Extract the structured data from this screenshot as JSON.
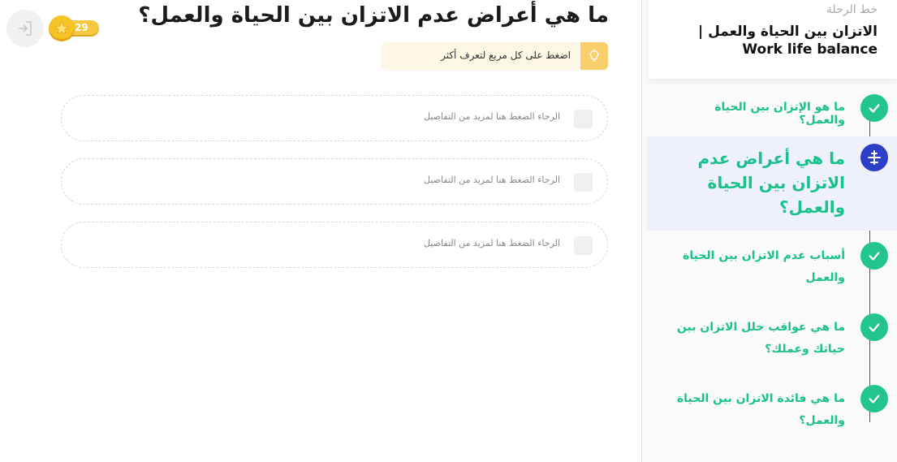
{
  "sidebar": {
    "caption": "خط الرحلة",
    "title_ar": "الاتزان بين الحياة والعمل |",
    "title_en": "Work life balance",
    "steps": [
      {
        "label": "ما هو الإتزان بين الحياة والعمل؟",
        "status": "completed"
      },
      {
        "label": "ما هي أعراض عدم الاتزان بين الحياة والعمل؟",
        "status": "current"
      },
      {
        "label": "أسباب عدم الاتزان بين الحياة والعمل",
        "status": "completed"
      },
      {
        "label": "ما هي عواقب خلل الاتزان بين حياتك وعملك؟",
        "status": "completed"
      },
      {
        "label": "ما هي فائدة الاتزان بين الحياة والعمل؟",
        "status": "completed"
      }
    ]
  },
  "header": {
    "title": "ما هي أعراض عدم الاتزان بين الحياة والعمل؟",
    "coins": "29",
    "hint": "اضغط على كل مربع لتعرف أكثر"
  },
  "cards": [
    {
      "text": "الرجاء الضغط هنا لمزيد من التفاصيل"
    },
    {
      "text": "الرجاء الضغط هنا لمزيد من التفاصيل"
    },
    {
      "text": "الرجاء الضغط هنا لمزيد من التفاصيل"
    }
  ],
  "icons": {
    "exit": "exit-icon",
    "coin": "star-coin-icon",
    "hint": "lightbulb-icon",
    "done": "check-icon",
    "current": "airplane-icon"
  },
  "colors": {
    "completed": "#22c58b",
    "current": "#2d3ec9",
    "step_text": "#19c28a",
    "coin": "#f6c327",
    "hint_bg": "#fdf7e5"
  }
}
